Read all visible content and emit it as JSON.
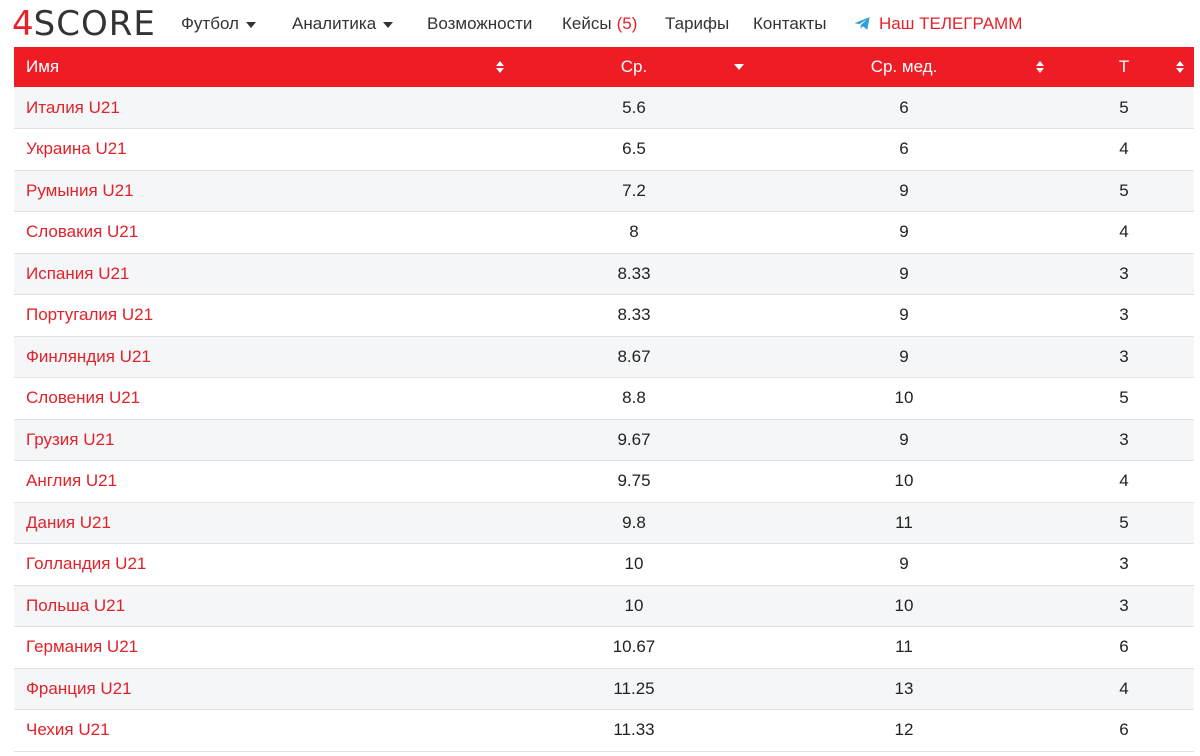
{
  "logo": {
    "digit": "4",
    "text": "SCORE"
  },
  "nav": {
    "football": "Футбол",
    "analytics": "Аналитика",
    "features": "Возможности",
    "cases": "Кейсы",
    "cases_count": "(5)",
    "pricing": "Тарифы",
    "contacts": "Контакты",
    "telegram": "Наш ТЕЛЕГРАММ",
    "telegram_icon": "telegram-plane-icon"
  },
  "colors": {
    "accent": "#ee1c25",
    "link": "#e3212a",
    "row_stripe": "#f5f6f8"
  },
  "table": {
    "columns": [
      "Имя",
      "Ср.",
      "Ср. мед.",
      "Т"
    ],
    "sort_column": "Ср.",
    "rows": [
      [
        "Италия U21",
        "5.6",
        "6",
        "5"
      ],
      [
        "Украина U21",
        "6.5",
        "6",
        "4"
      ],
      [
        "Румыния U21",
        "7.2",
        "9",
        "5"
      ],
      [
        "Словакия U21",
        "8",
        "9",
        "4"
      ],
      [
        "Испания U21",
        "8.33",
        "9",
        "3"
      ],
      [
        "Португалия U21",
        "8.33",
        "9",
        "3"
      ],
      [
        "Финляндия U21",
        "8.67",
        "9",
        "3"
      ],
      [
        "Словения U21",
        "8.8",
        "10",
        "5"
      ],
      [
        "Грузия U21",
        "9.67",
        "9",
        "3"
      ],
      [
        "Англия U21",
        "9.75",
        "10",
        "4"
      ],
      [
        "Дания U21",
        "9.8",
        "11",
        "5"
      ],
      [
        "Голландия U21",
        "10",
        "9",
        "3"
      ],
      [
        "Польша U21",
        "10",
        "10",
        "3"
      ],
      [
        "Германия U21",
        "10.67",
        "11",
        "6"
      ],
      [
        "Франция U21",
        "11.25",
        "13",
        "4"
      ],
      [
        "Чехия U21",
        "11.33",
        "12",
        "6"
      ]
    ]
  }
}
